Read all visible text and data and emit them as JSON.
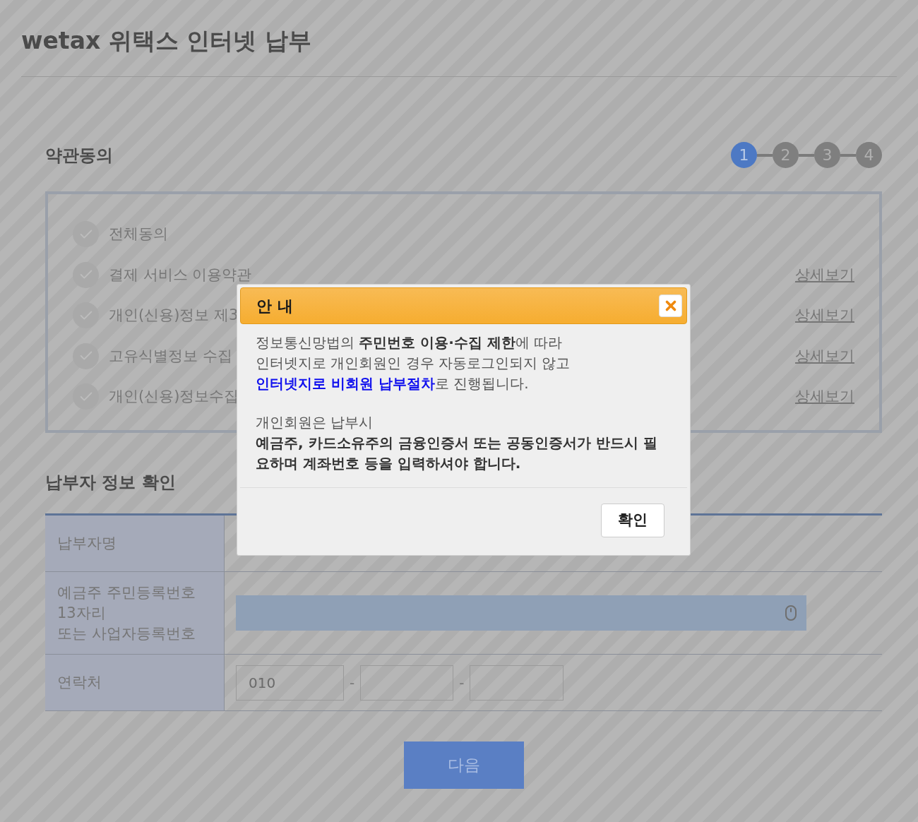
{
  "page": {
    "title": "wetax 위택스 인터넷 납부"
  },
  "terms": {
    "heading": "약관동의",
    "steps": [
      {
        "label": "1",
        "selected": true
      },
      {
        "label": "2",
        "selected": false
      },
      {
        "label": "3",
        "selected": false
      },
      {
        "label": "4",
        "selected": false
      }
    ],
    "items": [
      {
        "label": "전체동의",
        "checked": false
      },
      {
        "label": "결제 서비스 이용약관",
        "checked": false,
        "detail_link": "상세보기"
      },
      {
        "label": "개인(신용)정보 제3",
        "checked": false,
        "detail_link": "상세보기"
      },
      {
        "label": "고유식별정보 수집",
        "checked": false,
        "detail_link": "상세보기"
      },
      {
        "label": "개인(신용)정보수집",
        "checked": false,
        "detail_link": "상세보기"
      }
    ]
  },
  "payer": {
    "heading": "납부자 정보 확인",
    "rows": [
      {
        "kind": "covered",
        "label_lines": [
          "납부자명"
        ]
      },
      {
        "kind": "masked",
        "label_lines": [
          "예금주 주민등록번호",
          "13자리",
          "또는 사업자등록번호"
        ]
      },
      {
        "kind": "phone",
        "label_lines": [
          "연락처"
        ],
        "first": "010",
        "separators": [
          "-",
          "-"
        ]
      }
    ]
  },
  "next_button": "다음",
  "dialog": {
    "title": "안 내",
    "paragraphs": [
      [
        {
          "kind": "plain",
          "text": "정보통신망법의 **주민번호 이용·수집 제한**에 따라\n인터넷지로 개인회원인 경우 자동로그인되지 않고\n"
        },
        {
          "kind": "highlight",
          "text": "인터넷지로 비회원 납부절차"
        },
        {
          "kind": "plain",
          "text": "로 진행됩니다."
        }
      ],
      [
        {
          "kind": "plain",
          "text": "개인회원은 납부시\n**예금주, 카드소유주의 금융인증서 또는 공동인증서가 반드시 필요하며 계좌번호 등을 입력하셔야 합니다.**"
        }
      ]
    ],
    "confirm_button": "확인"
  }
}
